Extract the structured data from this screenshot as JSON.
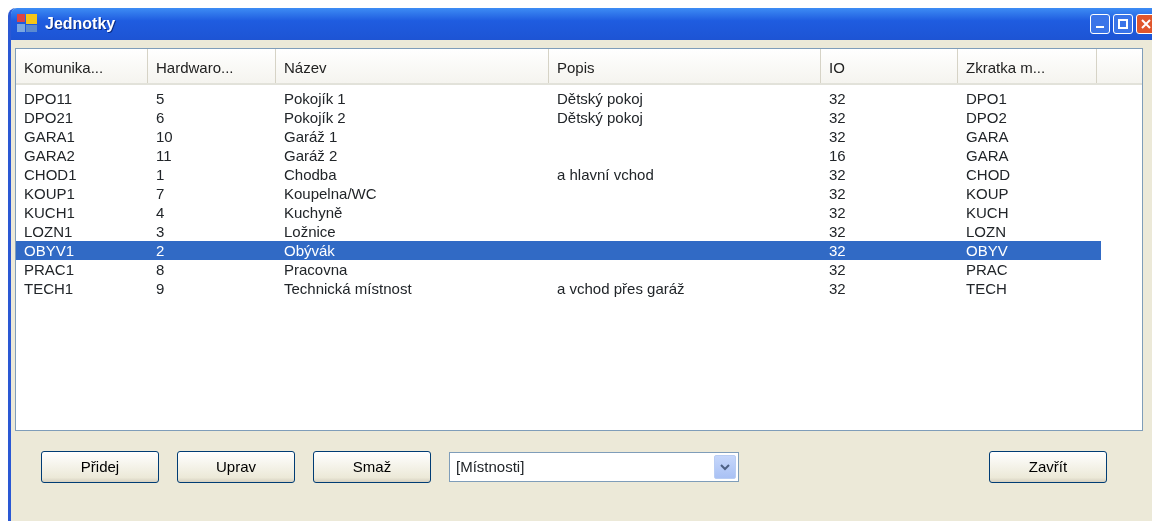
{
  "window": {
    "title": "Jednotky"
  },
  "table": {
    "columns": [
      "Komunika...",
      "Hardwaro...",
      "Název",
      "Popis",
      "IO",
      "Zkratka m..."
    ],
    "rows": [
      {
        "cells": [
          "DPO11",
          "5",
          "Pokojík 1",
          "Dětský pokoj",
          "32",
          "DPO1"
        ],
        "selected": false
      },
      {
        "cells": [
          "DPO21",
          "6",
          "Pokojík 2",
          "Dětský pokoj",
          "32",
          "DPO2"
        ],
        "selected": false
      },
      {
        "cells": [
          "GARA1",
          "10",
          "Garáž 1",
          "",
          "32",
          "GARA"
        ],
        "selected": false
      },
      {
        "cells": [
          "GARA2",
          "11",
          "Garáž 2",
          "",
          "16",
          "GARA"
        ],
        "selected": false
      },
      {
        "cells": [
          "CHOD1",
          "1",
          "Chodba",
          "a hlavní vchod",
          "32",
          "CHOD"
        ],
        "selected": false
      },
      {
        "cells": [
          "KOUP1",
          "7",
          "Koupelna/WC",
          "",
          "32",
          "KOUP"
        ],
        "selected": false
      },
      {
        "cells": [
          "KUCH1",
          "4",
          "Kuchyně",
          "",
          "32",
          "KUCH"
        ],
        "selected": false
      },
      {
        "cells": [
          "LOZN1",
          "3",
          "Ložnice",
          "",
          "32",
          "LOZN"
        ],
        "selected": false
      },
      {
        "cells": [
          "OBYV1",
          "2",
          "Obývák",
          "",
          "32",
          "OBYV"
        ],
        "selected": true
      },
      {
        "cells": [
          "PRAC1",
          "8",
          "Pracovna",
          "",
          "32",
          "PRAC"
        ],
        "selected": false
      },
      {
        "cells": [
          "TECH1",
          "9",
          "Technická místnost",
          "a vchod přes garáž",
          "32",
          "TECH"
        ],
        "selected": false
      }
    ]
  },
  "buttons": [
    "Přidej",
    "Uprav",
    "Smaž"
  ],
  "dropdown": {
    "value": "[Místnosti]"
  },
  "close_button": "Zavřít"
}
